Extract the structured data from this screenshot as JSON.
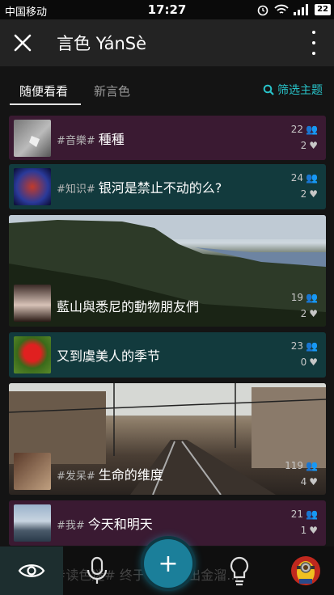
{
  "status": {
    "carrier": "中国移动",
    "time": "17:27",
    "battery": "22"
  },
  "appbar": {
    "title": "言色 YánSè"
  },
  "tabs": {
    "active": "随便看看",
    "inactive": "新言色",
    "filter": "筛选主题"
  },
  "cards": [
    {
      "tag": "#音樂#",
      "title": "種種",
      "members": "22",
      "likes": "2"
    },
    {
      "tag": "#知识#",
      "title": "银河是禁止不动的么?",
      "members": "24",
      "likes": "2"
    },
    {
      "tag": "",
      "title": "藍山與悉尼的動物朋友們",
      "members": "19",
      "likes": "2"
    },
    {
      "tag": "",
      "title": "又到虞美人的季节",
      "members": "23",
      "likes": "0"
    },
    {
      "tag": "#发呆#",
      "title": "生命的维度",
      "members": "119",
      "likes": "4"
    },
    {
      "tag": "#我#",
      "title": "今天和明天",
      "members": "21",
      "likes": "1"
    }
  ],
  "bottom": {
    "ghost": "#读色迷# 终于不... 牵出金溜..."
  },
  "colors": {
    "accent": "#28c3c9",
    "card_purple": "#3a1a32",
    "card_teal": "#123a3d"
  },
  "icons": [
    "close-icon",
    "more-icon",
    "search-icon",
    "members-icon",
    "heart-icon",
    "eye-icon",
    "microphone-icon",
    "plus-icon",
    "lightbulb-icon",
    "minion-avatar"
  ]
}
